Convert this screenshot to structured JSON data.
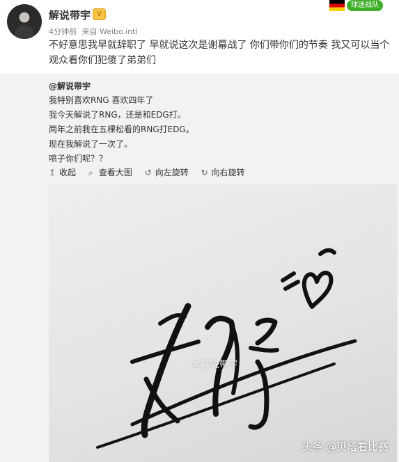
{
  "post": {
    "username": "解说带宇",
    "vip_badge": "V",
    "time": "4分钟前",
    "source": "来自 Weibo.intl",
    "fan_badge": "球迷战队",
    "text": "不好意思我早就辞职了 早就说这次是谢幕战了 你们带你们的节奏 我又可以当个观众看你们犯傻了弟弟们"
  },
  "repost": {
    "author": "@解说带宇",
    "lines": [
      "我特别喜欢RNG 喜欢四年了",
      "我今天解说了RNG，还是和EDG打。",
      "两年之前我在五棵松看的RNG打EDG。",
      "现在我解说了一次了。",
      "喷子你们呢？？"
    ],
    "toolbar": {
      "collapse": "收起",
      "view_large": "查看大图",
      "rotate_left": "向左旋转",
      "rotate_right": "向右旋转"
    },
    "watermark": "@解说带宇"
  },
  "overlay_watermark": "头条 @贝塔看比赛"
}
